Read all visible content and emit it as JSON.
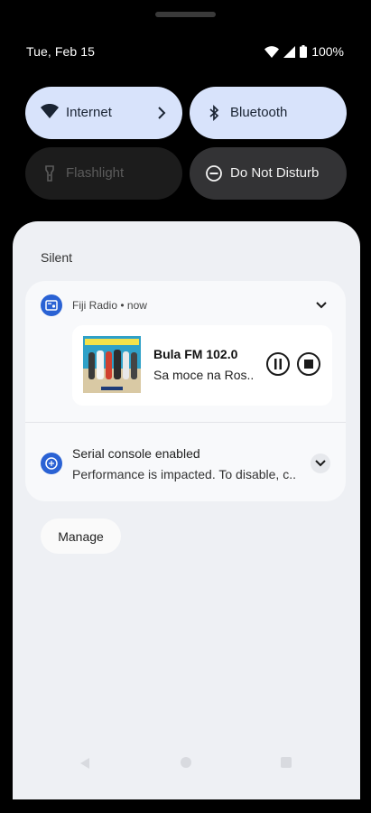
{
  "status_bar": {
    "date": "Tue, Feb 15",
    "battery": "100%",
    "icons": [
      "wifi-icon",
      "cell-signal-icon",
      "battery-icon"
    ]
  },
  "quick_settings": [
    {
      "label": "Internet",
      "icon": "wifi-icon",
      "active": true,
      "has_chevron": true
    },
    {
      "label": "Bluetooth",
      "icon": "bluetooth-icon",
      "active": true
    },
    {
      "label": "Flashlight",
      "icon": "flashlight-icon",
      "active": false
    },
    {
      "label": "Do Not Disturb",
      "icon": "dnd-icon",
      "active": false
    }
  ],
  "notifications": {
    "section_label": "Silent",
    "media": {
      "app_name": "Fiji Radio",
      "time": "now",
      "title": "Bula FM 102.0",
      "subtitle": "Sa moce na Ros..",
      "controls": [
        "pause",
        "stop"
      ]
    },
    "serial": {
      "title": "Serial console enabled",
      "body": "Performance is impacted. To disable, c.."
    },
    "manage_label": "Manage"
  },
  "colors": {
    "tile_active": "#d8e3fb",
    "tile_inactive": "#1c1c1c",
    "tile_dnd": "#333335",
    "sheet": "#eef0f4",
    "app_icon": "#2a62d4"
  }
}
